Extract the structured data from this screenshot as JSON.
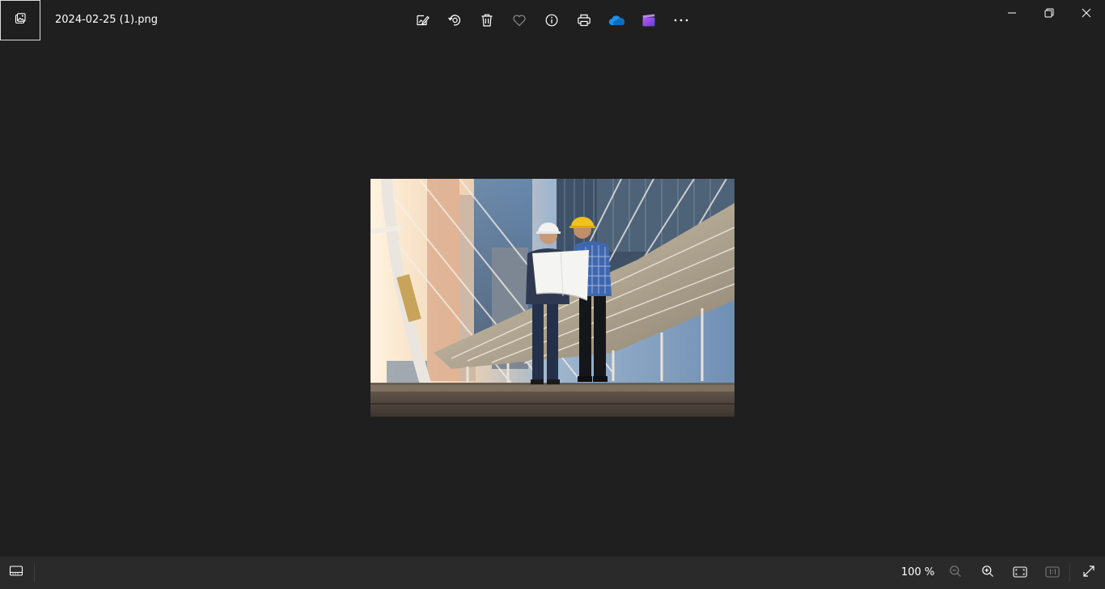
{
  "window": {
    "file_name": "2024-02-25 (1).png"
  },
  "toolbar": {
    "items": [
      {
        "name": "edit-image-icon"
      },
      {
        "name": "rotate-icon"
      },
      {
        "name": "delete-icon"
      },
      {
        "name": "favorite-heart-icon"
      },
      {
        "name": "info-icon"
      },
      {
        "name": "print-icon"
      },
      {
        "name": "onedrive-cloud-icon"
      },
      {
        "name": "clipchamp-icon"
      },
      {
        "name": "more-options-icon"
      }
    ]
  },
  "window_controls": {
    "minimize": "minimize-icon",
    "maximize": "restore-icon",
    "close": "close-icon"
  },
  "photo": {
    "subject": "two-engineers-with-hard-hats-reading-blueprint"
  },
  "bottom_bar": {
    "zoom_level": "100 %"
  },
  "colors": {
    "background": "#1f1f1f",
    "bottom_bar": "#2a2a2a",
    "icon": "#ffffff",
    "icon_disabled": "#7a7a7a",
    "onedrive_blue": "#1e90e8",
    "clipchamp_purple": "#8a4fe0",
    "hard_hat_yellow": "#f2c21b"
  }
}
